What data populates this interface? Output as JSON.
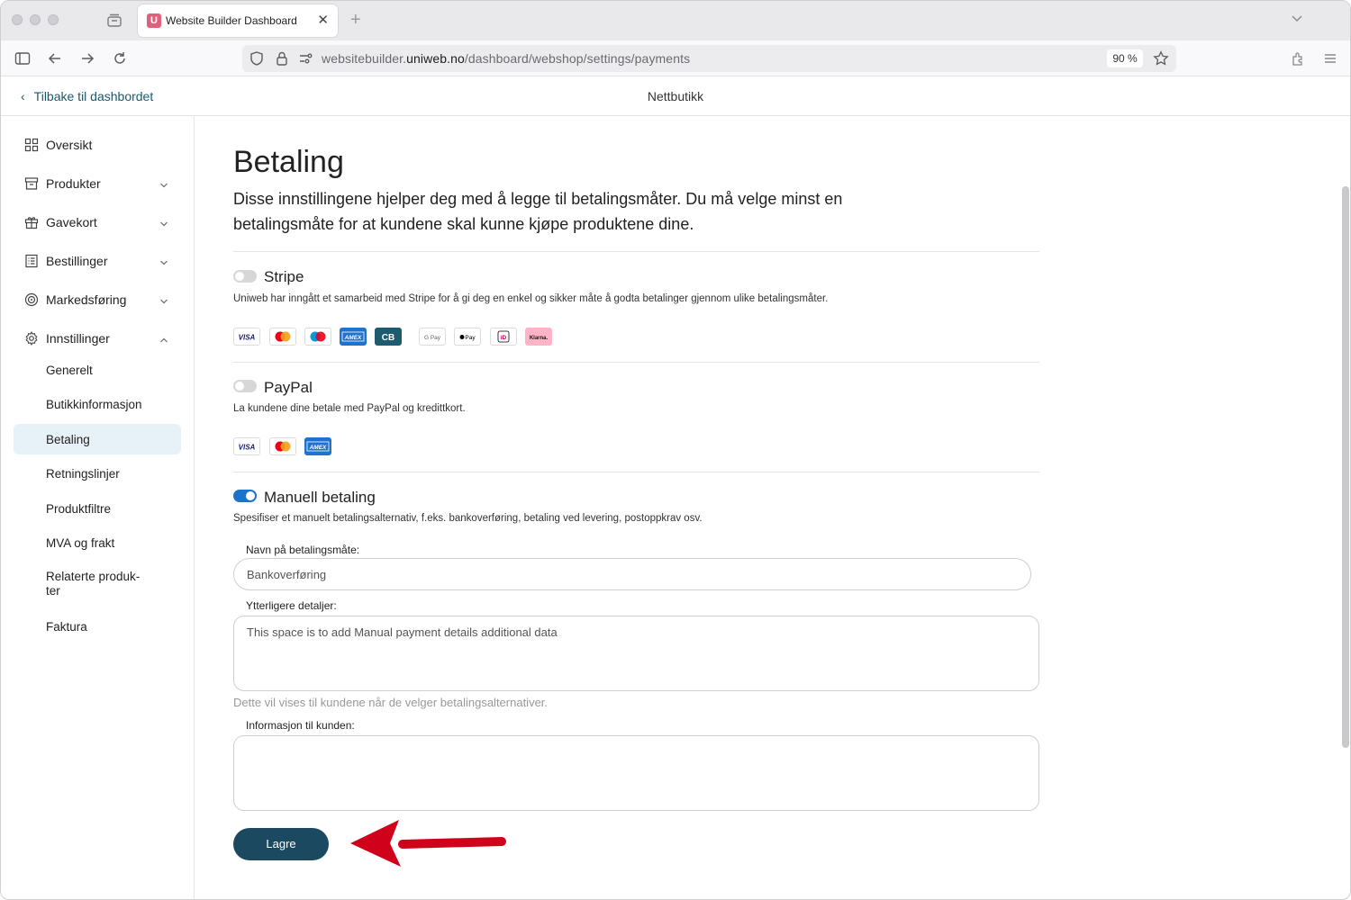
{
  "browser": {
    "tab_title": "Website Builder Dashboard",
    "favicon_letter": "U",
    "url_prefix": "websitebuilder.",
    "url_domain": "uniweb.no",
    "url_path": "/dashboard/webshop/settings/payments",
    "zoom": "90 %"
  },
  "header": {
    "back_label": "Tilbake til dashbordet",
    "title": "Nettbutikk"
  },
  "sidebar": {
    "items": [
      {
        "label": "Oversikt",
        "icon": "grid-icon"
      },
      {
        "label": "Produkter",
        "icon": "box-icon"
      },
      {
        "label": "Gavekort",
        "icon": "gift-icon"
      },
      {
        "label": "Bestillinger",
        "icon": "list-icon"
      },
      {
        "label": "Markedsføring",
        "icon": "target-icon"
      },
      {
        "label": "Innstillinger",
        "icon": "gear-icon"
      }
    ],
    "subitems": [
      {
        "label": "Generelt"
      },
      {
        "label": "Butikkinformasjon"
      },
      {
        "label": "Betaling",
        "active": true
      },
      {
        "label": "Retningslinjer"
      },
      {
        "label": "Produktfiltre"
      },
      {
        "label": "MVA og frakt"
      },
      {
        "label": "Relaterte produk-\nter"
      },
      {
        "label": "Faktura"
      }
    ]
  },
  "main": {
    "title": "Betaling",
    "description": "Disse innstillingene hjelper deg med å legge til betalingsmåter. Du må velge minst en betalingsmåte for at kundene skal kunne kjøpe produktene dine.",
    "stripe": {
      "title": "Stripe",
      "enabled": false,
      "description": "Uniweb har inngått et samarbeid med Stripe for å gi deg en enkel og sikker måte å godta betalinger gjennom ulike betalingsmåter.",
      "cards": [
        "VISA",
        "mastercard",
        "maestro",
        "AMEX",
        "CB",
        "G Pay",
        "Pay",
        "iD",
        "Klarna."
      ]
    },
    "paypal": {
      "title": "PayPal",
      "enabled": false,
      "description": "La kundene dine betale med PayPal og kredittkort.",
      "cards": [
        "VISA",
        "mastercard",
        "AMEX"
      ]
    },
    "manual": {
      "title": "Manuell betaling",
      "enabled": true,
      "description": "Spesifiser et manuelt betalingsalternativ, f.eks. bankoverføring, betaling ved levering, postoppkrav osv.",
      "name_label": "Navn på betalingsmåte:",
      "name_value": "Bankoverføring",
      "details_label": "Ytterligere detaljer:",
      "details_value": "This space is to add Manual payment details additional data",
      "details_hint": "Dette vil vises til kundene når de velger betalingsalternativer.",
      "info_label": "Informasjon til kunden:",
      "info_value": ""
    },
    "save_label": "Lagre"
  },
  "colors": {
    "accent": "#1b4a60",
    "toggle_on": "#1a73c9",
    "active_nav_bg": "#e7f1f8",
    "annotation_arrow": "#d0021b"
  }
}
